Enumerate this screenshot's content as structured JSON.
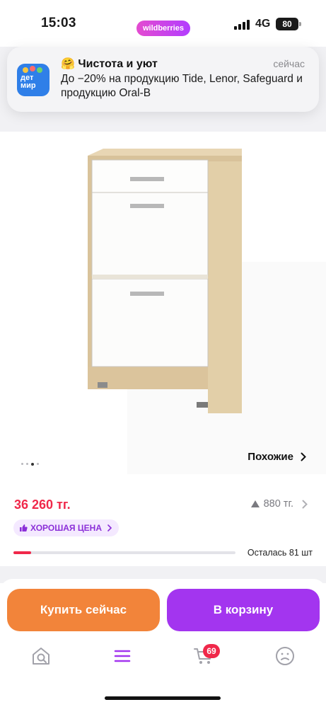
{
  "status_bar": {
    "time": "15:03",
    "app_pill": "wildberries",
    "network": "4G",
    "battery": "80"
  },
  "notification": {
    "emoji": "🤗",
    "title": "Чистота и уют",
    "time": "сейчас",
    "body": "До −20% на продукцию Tide, Lenor, Safeguard и продукцию Oral-B",
    "app_icon_text_top": "дет",
    "app_icon_text_bottom": "мир"
  },
  "gallery": {
    "similar_label": "Похожие",
    "slide_count": 4,
    "active_slide": 2
  },
  "price": {
    "current": "36 260 тг.",
    "change": "880 тг.",
    "badge": "ХОРОШАЯ ЦЕНА",
    "stock_label": "Осталась 81 шт",
    "stock_fraction": 0.08
  },
  "actions": {
    "buy_now": "Купить сейчас",
    "add_to_cart": "В корзину"
  },
  "tab_bar": {
    "cart_count": "69",
    "accent": "#a335ef"
  },
  "colors": {
    "price_red": "#f0284a",
    "buy_orange": "#f2843a",
    "cart_purple": "#a335ef"
  }
}
